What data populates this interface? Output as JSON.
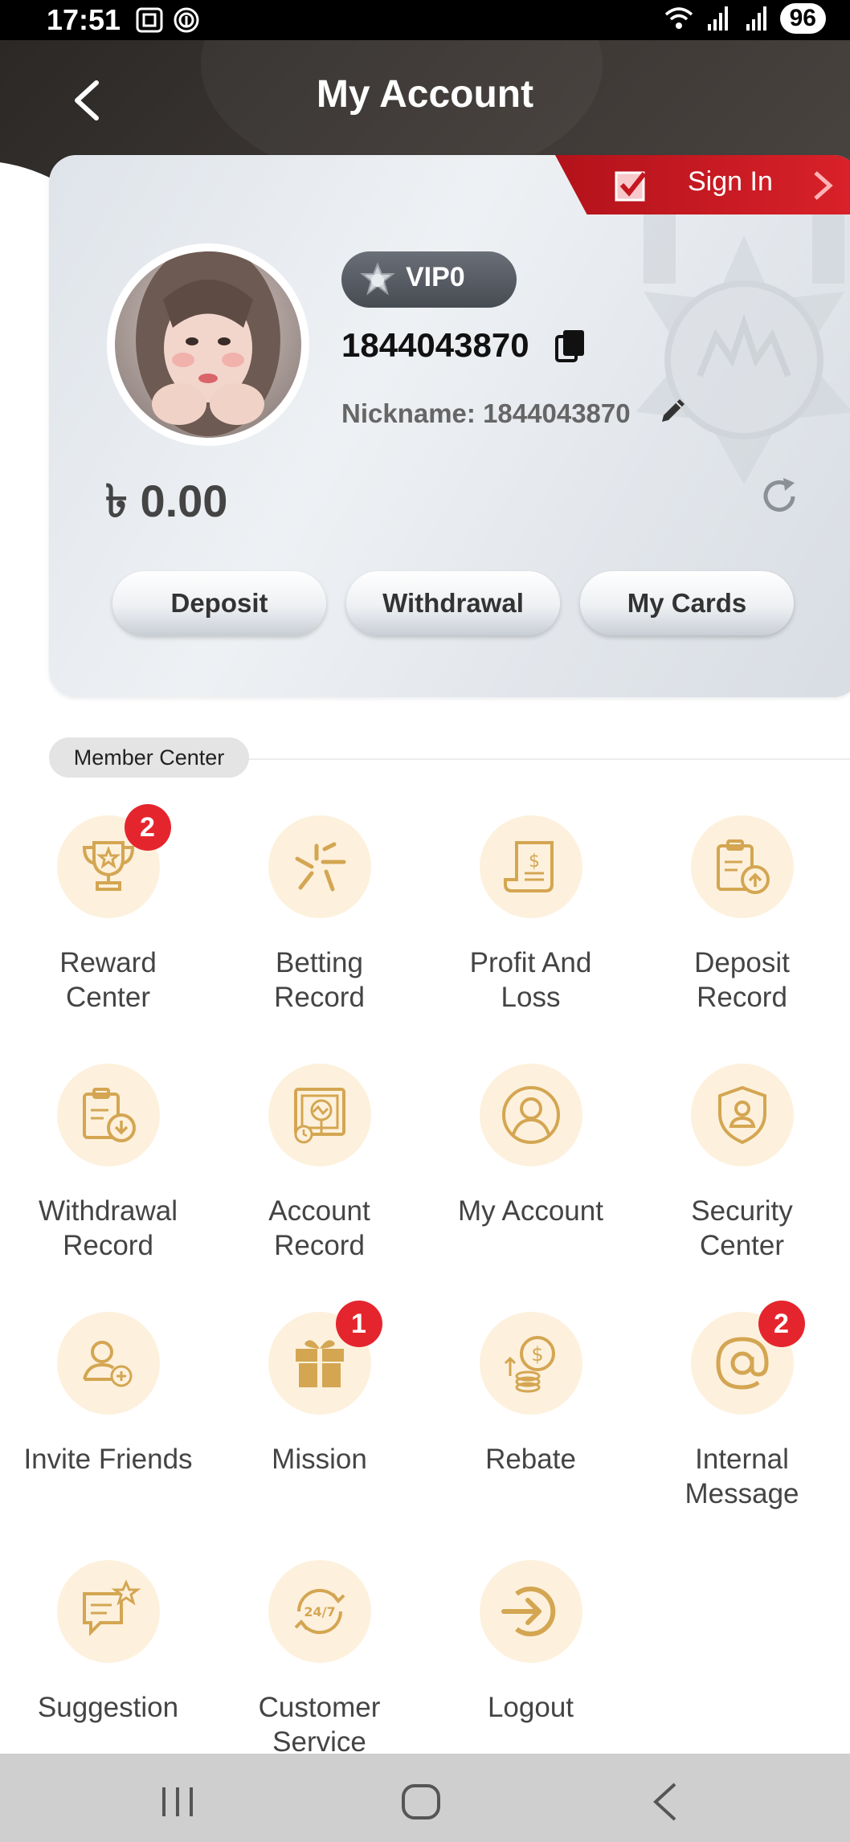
{
  "status_bar": {
    "time": "17:51",
    "battery": "96"
  },
  "header": {
    "title": "My Account"
  },
  "profile": {
    "sign_in_label": "Sign In",
    "vip_level": "VIP0",
    "user_id": "1844043870",
    "nickname": "Nickname: 1844043870",
    "balance": "৳ 0.00",
    "buttons": {
      "deposit": "Deposit",
      "withdrawal": "Withdrawal",
      "my_cards": "My Cards"
    }
  },
  "member_center": {
    "title": "Member Center",
    "items": [
      {
        "label": "Reward\nCenter",
        "icon": "trophy-icon",
        "badge": "2"
      },
      {
        "label": "Betting\nRecord",
        "icon": "betting-icon"
      },
      {
        "label": "Profit And\nLoss",
        "icon": "receipt-icon"
      },
      {
        "label": "Deposit\nRecord",
        "icon": "clipboard-upload-icon"
      },
      {
        "label": "Withdrawal\nRecord",
        "icon": "clipboard-download-icon"
      },
      {
        "label": "Account\nRecord",
        "icon": "account-record-icon"
      },
      {
        "label": "My Account",
        "icon": "user-icon"
      },
      {
        "label": "Security\nCenter",
        "icon": "shield-icon"
      },
      {
        "label": "Invite Friends",
        "icon": "user-add-icon"
      },
      {
        "label": "Mission",
        "icon": "gift-icon",
        "badge": "1"
      },
      {
        "label": "Rebate",
        "icon": "coins-icon"
      },
      {
        "label": "Internal\nMessage",
        "icon": "at-icon",
        "badge": "2"
      },
      {
        "label": "Suggestion",
        "icon": "chat-icon"
      },
      {
        "label": "Customer\nService",
        "icon": "support-icon"
      },
      {
        "label": "Logout",
        "icon": "logout-icon"
      }
    ]
  },
  "colors": {
    "accent_gold": "#d4a652",
    "icon_bg": "#fdf1dd",
    "badge_red": "#e5252e",
    "signin_red": "#d61f27"
  }
}
